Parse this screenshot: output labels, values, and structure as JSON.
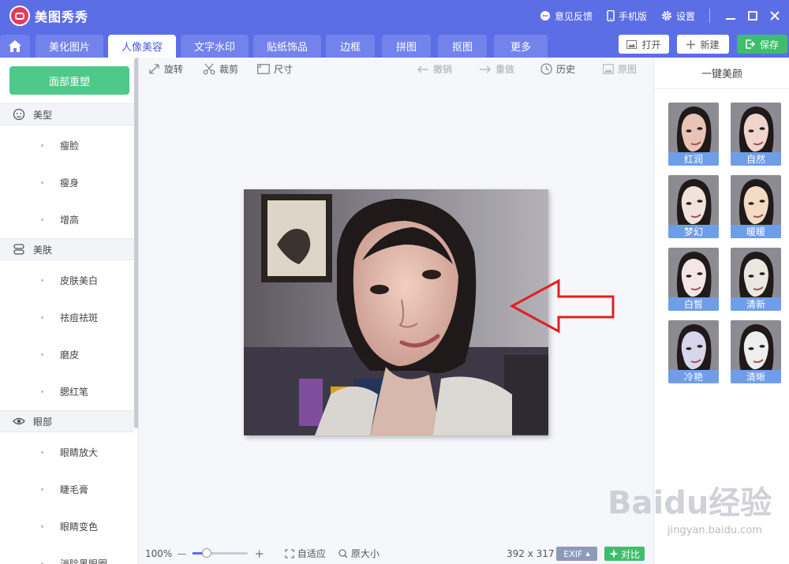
{
  "app": {
    "title": "美图秀秀"
  },
  "titlebar": {
    "feedback": "意见反馈",
    "mobile": "手机版",
    "settings": "设置"
  },
  "tabs": [
    {
      "label": "美化图片"
    },
    {
      "label": "人像美容"
    },
    {
      "label": "文字水印"
    },
    {
      "label": "贴纸饰品"
    },
    {
      "label": "边框"
    },
    {
      "label": "拼图"
    },
    {
      "label": "抠图"
    },
    {
      "label": "更多"
    }
  ],
  "active_tab": "人像美容",
  "actions": {
    "open": "打开",
    "new": "新建",
    "save": "保存"
  },
  "left": {
    "reset": "面部重塑",
    "sections": [
      {
        "label": "美型",
        "icon": "face-icon",
        "items": [
          "瘦脸",
          "瘦身",
          "增高"
        ]
      },
      {
        "label": "美肤",
        "icon": "skin-icon",
        "items": [
          "皮肤美白",
          "祛痘祛斑",
          "磨皮",
          "腮红笔"
        ]
      },
      {
        "label": "眼部",
        "icon": "eye-icon",
        "items": [
          "眼睛放大",
          "睫毛膏",
          "眼睛变色",
          "消除黑眼圈"
        ]
      }
    ]
  },
  "toolbar": {
    "rotate": "旋转",
    "crop": "裁剪",
    "size": "尺寸",
    "undo": "撤销",
    "redo": "重做",
    "history": "历史",
    "original": "原图"
  },
  "bottom": {
    "zoom": "100%",
    "zoom_fraction": 0.25,
    "fit": "自适应",
    "actual": "原大小",
    "dims": "392 x 317",
    "exif": "EXIF",
    "compare": "对比"
  },
  "right": {
    "title": "一键美颜",
    "presets": [
      "红润",
      "自然",
      "梦幻",
      "暖暖",
      "白皙",
      "清新",
      "冷艳",
      "清晰"
    ]
  },
  "watermark": {
    "main": "Baidu经验",
    "sub": "jingyan.baidu.com"
  },
  "colors": {
    "brand": "#5c6ee6",
    "accent_green": "#3ebe6b",
    "reset_green": "#4ec989",
    "arrow_red": "#e02020"
  }
}
